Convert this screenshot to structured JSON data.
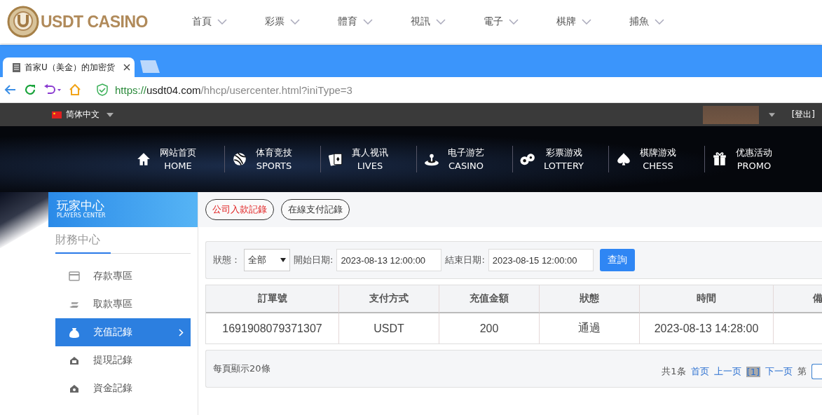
{
  "site_header": {
    "logo_text": "USDT CASINO",
    "nav": [
      "首頁",
      "彩票",
      "體育",
      "視訊",
      "電子",
      "棋牌",
      "捕魚"
    ]
  },
  "browser": {
    "tab_title": "首家U（美金）的加密货",
    "url_scheme": "https://",
    "url_host": "usdt04.com",
    "url_path": "/hhcp/usercenter.html?iniType=3"
  },
  "top_bar": {
    "language": "简体中文",
    "logout": "[登出]"
  },
  "main_nav": [
    {
      "zh": "网站首页",
      "en": "HOME"
    },
    {
      "zh": "体育竞技",
      "en": "SPORTS"
    },
    {
      "zh": "真人视讯",
      "en": "LIVES"
    },
    {
      "zh": "电子游艺",
      "en": "CASINO"
    },
    {
      "zh": "彩票游戏",
      "en": "LOTTERY"
    },
    {
      "zh": "棋牌游戏",
      "en": "CHESS"
    },
    {
      "zh": "优惠活动",
      "en": "PROMO"
    }
  ],
  "sidebar": {
    "title": "玩家中心",
    "subtitle": "PLAYERS CENTER",
    "section": "財務中心",
    "items": [
      {
        "label": "存款專區",
        "selected": false
      },
      {
        "label": "取款專區",
        "selected": false
      },
      {
        "label": "充值記錄",
        "selected": true
      },
      {
        "label": "提現記錄",
        "selected": false
      },
      {
        "label": "資金記錄",
        "selected": false
      }
    ]
  },
  "record_tabs": [
    {
      "label": "公司入款記錄",
      "selected": true
    },
    {
      "label": "在線支付記錄",
      "selected": false
    }
  ],
  "filter": {
    "status_label": "狀態：",
    "status_value": "全部",
    "start_label": "開始日期:",
    "start_value": "2023-08-13 12:00:00",
    "end_label": "結束日期:",
    "end_value": "2023-08-15 12:00:00",
    "query_button": "查詢"
  },
  "table": {
    "columns": [
      "訂單號",
      "支付方式",
      "充值金額",
      "狀態",
      "時間",
      "備"
    ],
    "rows": [
      [
        "1691908079371307",
        "USDT",
        "200",
        "通過",
        "2023-08-13 14:28:00",
        ""
      ]
    ]
  },
  "footer": {
    "per_page": "每頁顯示20條",
    "pager": {
      "total": "共1条",
      "first": "首页",
      "prev": "上一页",
      "current": "[1]",
      "next": "下一页",
      "page_label": "第"
    }
  }
}
